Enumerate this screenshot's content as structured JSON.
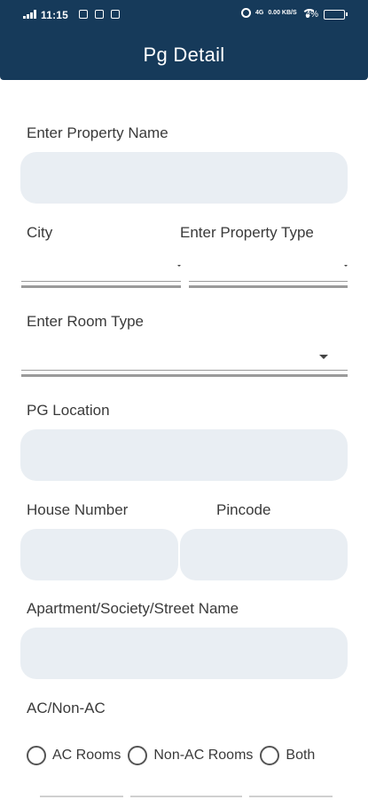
{
  "status_bar": {
    "time": "11:15",
    "network_label": "4G",
    "speed_label": "0.00 KB/S",
    "battery_percent": "4%"
  },
  "header": {
    "title": "Pg Detail",
    "color": "#163a5a"
  },
  "form": {
    "property_name": {
      "label": "Enter Property Name",
      "value": ""
    },
    "city": {
      "label": "City",
      "value": ""
    },
    "property_type": {
      "label": "Enter Property Type",
      "value": ""
    },
    "room_type": {
      "label": "Enter Room Type",
      "value": ""
    },
    "pg_location": {
      "label": "PG Location",
      "value": ""
    },
    "house_number": {
      "label": "House Number",
      "value": ""
    },
    "pincode": {
      "label": "Pincode",
      "value": ""
    },
    "street": {
      "label": "Apartment/Society/Street Name",
      "value": ""
    },
    "ac_type": {
      "label": "AC/Non-AC",
      "options": [
        "AC Rooms",
        "Non-AC Rooms",
        "Both"
      ],
      "selected": null
    }
  },
  "field_color": "#e9eef3"
}
